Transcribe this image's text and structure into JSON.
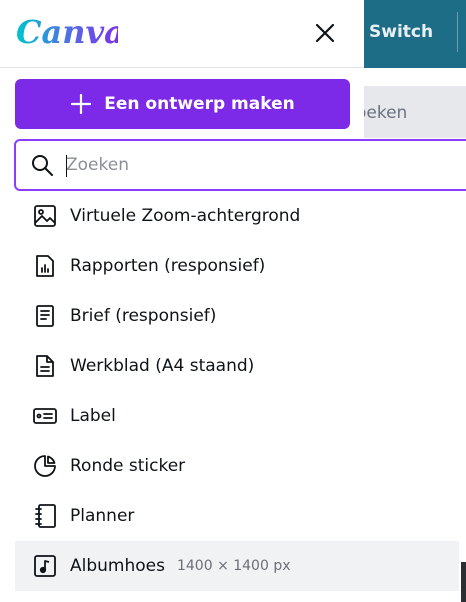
{
  "app": {
    "logo_text": "Canva",
    "brand_color": "#7d2ae8"
  },
  "background": {
    "switch_label": "Switch",
    "search_fragment": "oeken"
  },
  "header": {
    "close_label": "×"
  },
  "create_button": {
    "label": "Een ontwerp maken"
  },
  "search": {
    "placeholder": "Zoeken",
    "value": ""
  },
  "items": [
    {
      "label": "Virtuele Zoom-achtergrond",
      "icon": "image-icon"
    },
    {
      "label": "Rapporten (responsief)",
      "icon": "report-icon"
    },
    {
      "label": "Brief (responsief)",
      "icon": "letter-icon"
    },
    {
      "label": "Werkblad (A4 staand)",
      "icon": "worksheet-icon"
    },
    {
      "label": "Label",
      "icon": "label-icon"
    },
    {
      "label": "Ronde sticker",
      "icon": "round-sticker-icon"
    },
    {
      "label": "Planner",
      "icon": "planner-icon"
    },
    {
      "label": "Albumhoes",
      "icon": "album-icon",
      "meta": "1400 × 1400 px",
      "hovered": true
    }
  ]
}
